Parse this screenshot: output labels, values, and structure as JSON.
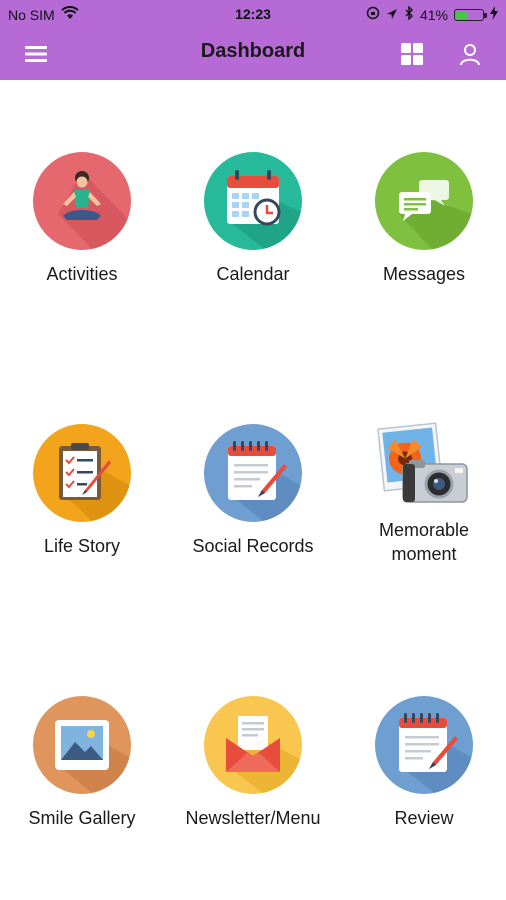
{
  "status_bar": {
    "carrier": "No SIM",
    "time": "12:23",
    "battery_percent": "41%",
    "battery_level": 0.41,
    "icons": [
      "wifi-icon",
      "lock-rotation-icon",
      "location-icon",
      "bluetooth-icon",
      "battery-icon",
      "charging-icon"
    ]
  },
  "header": {
    "title": "Dashboard",
    "background": "#b56ad6",
    "left_icon": "menu-icon",
    "right_icons": [
      "grid-icon",
      "user-icon"
    ]
  },
  "tiles": [
    {
      "label": "Activities",
      "icon": "yoga-icon",
      "color": "#e5686f"
    },
    {
      "label": "Calendar",
      "icon": "calendar-icon",
      "color": "#26b99a"
    },
    {
      "label": "Messages",
      "icon": "chat-icon",
      "color": "#7fc13f"
    },
    {
      "label": "Life Story",
      "icon": "checklist-icon",
      "color": "#f2a41c"
    },
    {
      "label": "Social Records",
      "icon": "notepad-pen-icon",
      "color": "#6f9ed1"
    },
    {
      "label": "Memorable moment",
      "icon": "camera-photo-icon",
      "color": "#ffffff"
    },
    {
      "label": "Smile Gallery",
      "icon": "picture-icon",
      "color": "#e0955c"
    },
    {
      "label": "Newsletter/Menu",
      "icon": "envelope-icon",
      "color": "#f9c74f"
    },
    {
      "label": "Review",
      "icon": "notepad-pen-icon",
      "color": "#6f9ed1"
    }
  ]
}
